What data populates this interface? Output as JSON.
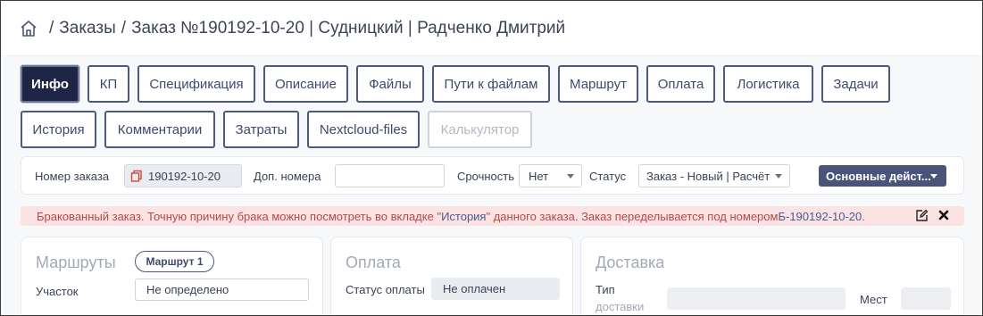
{
  "breadcrumb": {
    "items": [
      "Заказы",
      "Заказ №190192-10-20 | Судницкий | Радченко Дмитрий"
    ]
  },
  "tabs_row1": [
    "Инфо",
    "КП",
    "Спецификация",
    "Описание",
    "Файлы",
    "Пути к файлам",
    "Маршрут",
    "Оплата",
    "Логистика",
    "Задачи"
  ],
  "tabs_row2": [
    "История",
    "Комментарии",
    "Затраты",
    "Nextcloud-files",
    "Калькулятор"
  ],
  "active_tab": "Инфо",
  "disabled_tab": "Калькулятор",
  "form": {
    "order_number_label": "Номер заказа",
    "order_number_value": "190192-10-20",
    "extra_numbers_label": "Доп. номера",
    "extra_numbers_value": "",
    "urgency_label": "Срочность",
    "urgency_value": "Нет",
    "status_label": "Статус",
    "status_value": "Заказ - Новый | Расчёт",
    "main_actions_label": "Основные дейст..."
  },
  "alert": {
    "text_before": "Бракованный заказ. Точную причину брака можно посмотреть во вкладке \"",
    "history_link": "История",
    "text_middle": "\" данного заказа. Заказ переделывается под номером ",
    "order_link": "Б-190192-10-20",
    "text_after": " ."
  },
  "cards": {
    "routes": {
      "title": "Маршруты",
      "route_pill": "Маршрут 1",
      "section_label": "Участок",
      "section_value": "Не определено"
    },
    "payment": {
      "title": "Оплата",
      "status_label": "Статус оплаты",
      "status_value": "Не оплачен"
    },
    "delivery": {
      "title": "Доставка",
      "type_label_line1": "Тип",
      "type_label_line2": "доставки",
      "places_label": "Мест"
    }
  },
  "colors": {
    "active_tab_bg": "#1f2544",
    "tab_border": "#4c5a7d",
    "alert_bg": "#fbe3e3",
    "alert_text": "#b24a4a",
    "action_btn_bg": "#4a5378"
  }
}
